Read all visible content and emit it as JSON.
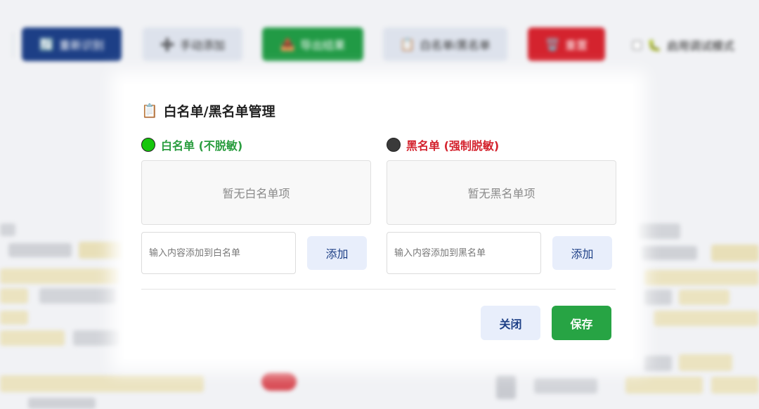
{
  "toolbar": {
    "reidentify": {
      "icon": "🔄",
      "label": "重新识别"
    },
    "manual_add": {
      "icon": "➕",
      "label": "手动添加"
    },
    "export": {
      "icon": "📤",
      "label": "导出结果"
    },
    "list": {
      "icon": "📋",
      "label": "白名单/黑名单"
    },
    "reset": {
      "icon": "🗑️",
      "label": "重置"
    },
    "debug": {
      "icon": "🐛",
      "label": "启用调试模式"
    }
  },
  "dialog": {
    "title_icon": "📋",
    "title": "白名单/黑名单管理",
    "whitelist": {
      "header": "白名单 (不脱敏)",
      "empty_text": "暂无白名单项",
      "input_placeholder": "输入内容添加到白名单",
      "add_label": "添加"
    },
    "blacklist": {
      "header": "黑名单 (强制脱敏)",
      "empty_text": "暂无黑名单项",
      "input_placeholder": "输入内容添加到黑名单",
      "add_label": "添加"
    },
    "close_label": "关闭",
    "save_label": "保存"
  },
  "colors": {
    "primary": "#1d3f86",
    "success": "#27a444",
    "danger": "#d4232e",
    "whitelist_header": "#2a9d3f",
    "blacklist_header": "#d4232e"
  }
}
